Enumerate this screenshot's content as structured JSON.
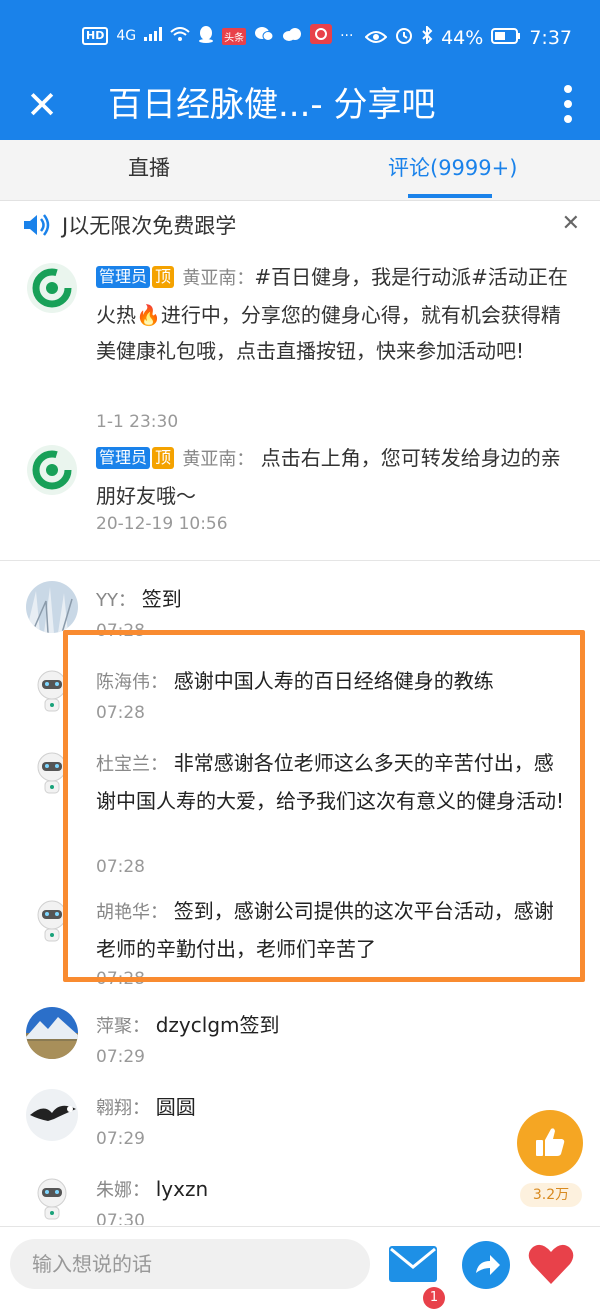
{
  "status_bar": {
    "hd": "HD",
    "network": "4G",
    "toutiao": "头条",
    "more": "···",
    "battery": "44%",
    "time": "7:37"
  },
  "header": {
    "title": "百日经脉健...- 分享吧"
  },
  "tabs": [
    {
      "label": "直播"
    },
    {
      "label": "评论(9999+)",
      "active": true
    }
  ],
  "notice": {
    "text": "J以无限次免费跟学"
  },
  "pinned": [
    {
      "badge_admin": "管理员",
      "badge_top": "顶",
      "name": "黄亚南",
      "text": "#百日健身，我是行动派#活动正在火热🔥进行中，分享您的健身心得，就有机会获得精美健康礼包哦，点击直播按钮，快来参加活动吧!",
      "time": "1-1 23:30"
    },
    {
      "badge_admin": "管理员",
      "badge_top": "顶",
      "name": "黄亚南",
      "text": "点击右上角，您可转发给身边的亲朋好友哦～",
      "time": "20-12-19 10:56"
    }
  ],
  "comments": [
    {
      "name": "YY",
      "text": "签到",
      "time": "07:28",
      "avatar": "tree-photo"
    },
    {
      "name": "陈海伟",
      "text": "感谢中国人寿的百日经络健身的教练",
      "time": "07:28",
      "avatar": "robot"
    },
    {
      "name": "杜宝兰",
      "text": "非常感谢各位老师这么多天的辛苦付出，感谢中国人寿的大爱，给予我们这次有意义的健身活动!",
      "time": "07:28",
      "avatar": "robot"
    },
    {
      "name": "胡艳华",
      "text": "签到，感谢公司提供的这次平台活动，感谢老师的辛勤付出，老师们辛苦了",
      "time": "07:28",
      "avatar": "robot"
    },
    {
      "name": "萍聚",
      "text": "dzyclgm签到",
      "time": "07:29",
      "avatar": "mountain-photo"
    },
    {
      "name": "翱翔",
      "text": "圆圆",
      "time": "07:29",
      "avatar": "eagle-photo"
    },
    {
      "name": "朱娜",
      "text": "lyxzn",
      "time": "07:30",
      "avatar": "robot"
    }
  ],
  "like": {
    "count": "3.2万"
  },
  "input": {
    "placeholder": "输入想说的话"
  },
  "mail_badge": "1",
  "colors": {
    "brand_blue": "#1a82ea",
    "highlight_orange": "#f98b30",
    "like_gold": "#f5a623",
    "heart_red": "#e8414a"
  }
}
